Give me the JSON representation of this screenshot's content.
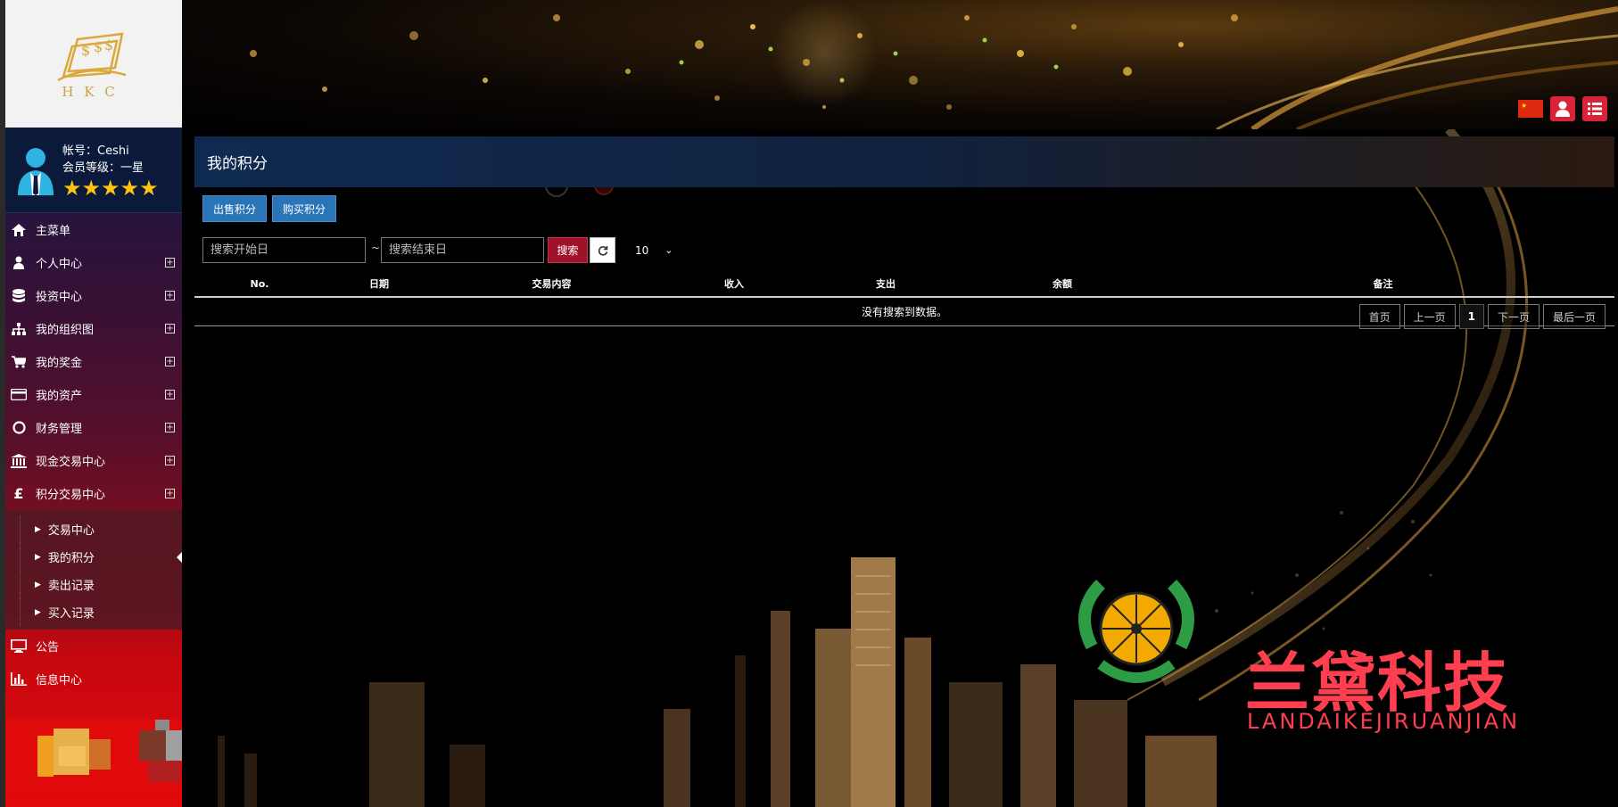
{
  "logo": {
    "text": "HKC"
  },
  "user": {
    "account_label": "帐号：Ceshi",
    "level_label": "会员等级：一星",
    "stars": "★★★★★"
  },
  "nav": {
    "main_menu": "主菜单",
    "items": [
      {
        "label": "个人中心",
        "icon": "user-icon"
      },
      {
        "label": "投资中心",
        "icon": "database-icon"
      },
      {
        "label": "我的组织图",
        "icon": "sitemap-icon"
      },
      {
        "label": "我的奖金",
        "icon": "cart-icon"
      },
      {
        "label": "我的资产",
        "icon": "credit-card-icon"
      },
      {
        "label": "财务管理",
        "icon": "circle-icon"
      },
      {
        "label": "现金交易中心",
        "icon": "bank-icon"
      },
      {
        "label": "积分交易中心",
        "icon": "pound-icon"
      }
    ],
    "sub_items": [
      "交易中心",
      "我的积分",
      "卖出记录",
      "买入记录"
    ],
    "active_sub": "我的积分",
    "after_items": [
      {
        "label": "公告",
        "icon": "monitor-icon"
      },
      {
        "label": "信息中心",
        "icon": "bar-chart-icon"
      }
    ]
  },
  "page": {
    "title": "我的积分",
    "sell_button": "出售积分",
    "buy_button": "购买积分",
    "start_placeholder": "搜索开始日",
    "end_placeholder": "搜索结束日",
    "tilde": "~",
    "search_button": "搜索",
    "page_size": "10"
  },
  "table": {
    "headers": [
      "No.",
      "日期",
      "交易内容",
      "收入",
      "支出",
      "余额",
      "备注"
    ],
    "empty_message": "没有搜索到数据。"
  },
  "pagination": {
    "first": "首页",
    "prev": "上一页",
    "current": "1",
    "next": "下一页",
    "last": "最后一页"
  },
  "watermark": {
    "title": "兰黛科技",
    "subtitle": "LANDAIKEJIRUANJIAN"
  },
  "colors": {
    "accent_blue": "#2a74b8",
    "search_red": "#a0122a",
    "star_gold": "#ffc20e",
    "watermark_red": "#ff3f50"
  }
}
